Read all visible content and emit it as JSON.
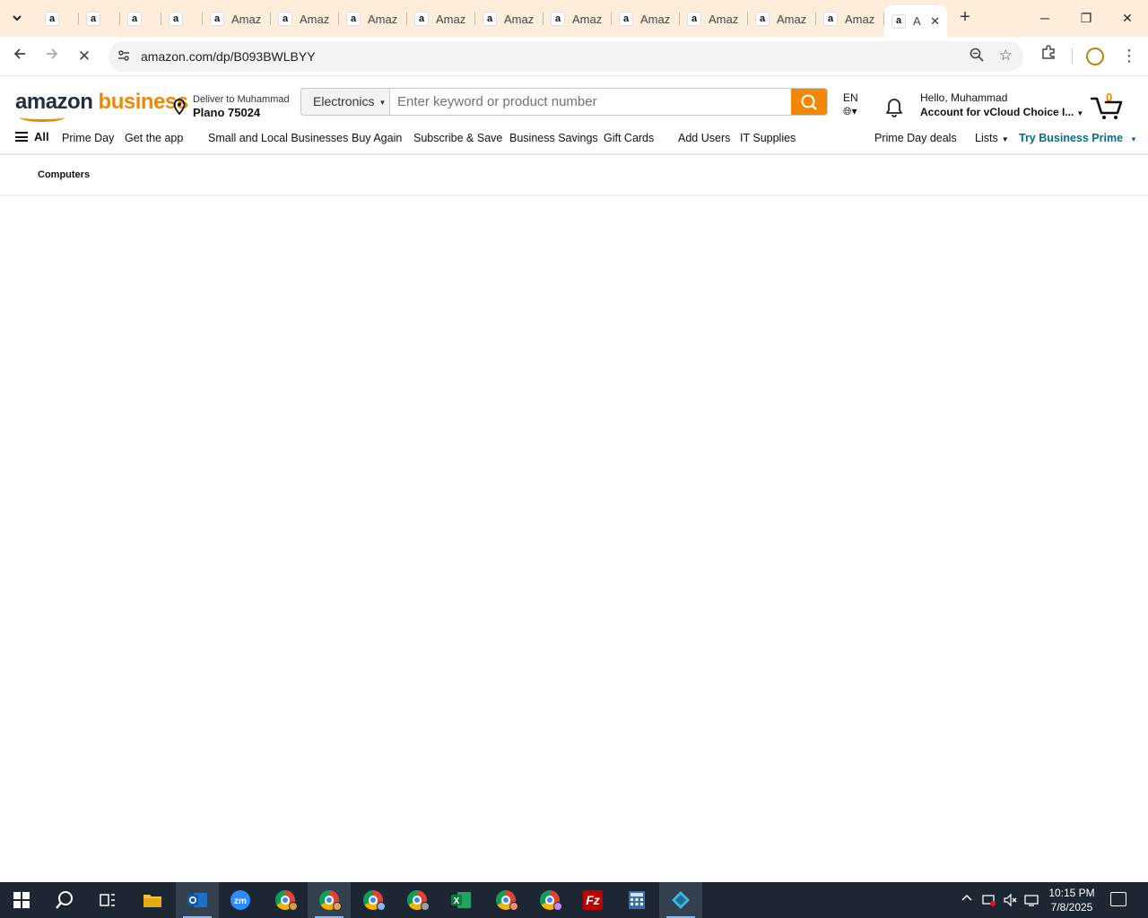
{
  "browser": {
    "tabs": [
      {
        "label": "",
        "favicon": "a",
        "size": "small"
      },
      {
        "label": "",
        "favicon": "a",
        "size": "small"
      },
      {
        "label": "",
        "favicon": "a",
        "size": "small"
      },
      {
        "label": "",
        "favicon": "a",
        "size": "small"
      },
      {
        "label": "Amaz",
        "favicon": "a",
        "size": "wide"
      },
      {
        "label": "Amaz",
        "favicon": "a",
        "size": "wide"
      },
      {
        "label": "Amaz",
        "favicon": "a",
        "size": "wide"
      },
      {
        "label": "Amaz",
        "favicon": "a",
        "size": "wide"
      },
      {
        "label": "Amaz",
        "favicon": "a",
        "size": "wide"
      },
      {
        "label": "Amaz",
        "favicon": "a",
        "size": "wide"
      },
      {
        "label": "Amaz",
        "favicon": "a",
        "size": "wide"
      },
      {
        "label": "Amaz",
        "favicon": "a",
        "size": "wide"
      },
      {
        "label": "Amaz",
        "favicon": "a",
        "size": "wide"
      },
      {
        "label": "Amaz",
        "favicon": "a",
        "size": "wide"
      }
    ],
    "active_tab": {
      "label": "A",
      "favicon": "a"
    },
    "new_tab_icon": "plus-icon",
    "url": "amazon.com/dp/B093BWLBYY",
    "loading": true
  },
  "header": {
    "logo_word1": "amazon",
    "logo_word2": "business",
    "deliver_to": "Deliver to Muhammad",
    "location": "Plano 75024",
    "search_category": "Electronics",
    "search_placeholder": "Enter keyword or product number",
    "language": "EN",
    "greeting": "Hello, Muhammad",
    "account": "Account for vCloud Choice I...",
    "cart_count": "0",
    "accent_color": "#f08804"
  },
  "nav": {
    "all": "All",
    "items": [
      "Prime Day",
      "Get the app",
      "Small and Local Businesses",
      "Buy Again",
      "Subscribe & Save",
      "Business Savings",
      "Gift Cards",
      "Add Users",
      "IT Supplies"
    ],
    "prime_day_deals": "Prime Day deals",
    "lists": "Lists",
    "try_prime": "Try Business Prime"
  },
  "subnav": {
    "category": "Computers"
  },
  "taskbar": {
    "apps": [
      "start",
      "search",
      "task-view",
      "file-explorer",
      "outlook",
      "zoom",
      "chrome",
      "chrome",
      "chrome",
      "chrome",
      "excel",
      "chrome",
      "chrome",
      "filezilla",
      "calculator",
      "app"
    ],
    "time": "10:15 PM",
    "date": "7/8/2025"
  }
}
